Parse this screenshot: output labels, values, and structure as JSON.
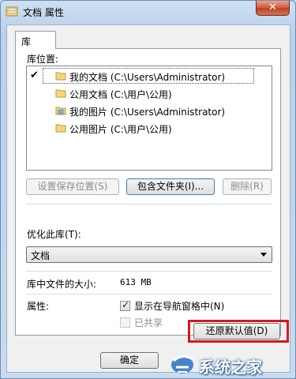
{
  "window": {
    "title": "文档 属性",
    "close_label": "✕"
  },
  "tabs": [
    {
      "label": "库"
    }
  ],
  "library_locations": {
    "label": "库位置:",
    "items": [
      {
        "text": "我的文档 (C:\\Users\\Administrator)",
        "checked": true,
        "icon": "folder-icon"
      },
      {
        "text": "公用文档 (C:\\用户\\公用)",
        "checked": false,
        "icon": "folder-icon"
      },
      {
        "text": "我的图片 (C:\\Users\\Administrator)",
        "checked": false,
        "icon": "pictures-folder-icon"
      },
      {
        "text": "公用图片 (C:\\用户\\公用)",
        "checked": false,
        "icon": "folder-icon"
      }
    ]
  },
  "location_buttons": {
    "set_save_location": "设置保存位置(S)",
    "include_folder": "包含文件夹(I)...",
    "remove": "删除(R)"
  },
  "optimize": {
    "label": "优化此库(T):",
    "selected": "文档"
  },
  "size": {
    "label": "库中文件的大小:",
    "value": "613 MB"
  },
  "attributes": {
    "label": "属性:",
    "show_in_nav": {
      "label": "显示在导航窗格中(N)",
      "checked": true
    },
    "shared": {
      "label": "已共享",
      "checked": false,
      "disabled": true
    }
  },
  "restore_defaults": "还原默认值(D)",
  "footer": {
    "ok": "确定"
  },
  "watermark": {
    "text": "系统之家"
  },
  "colors": {
    "highlight": "#d41a1a",
    "close_button": "#c03f1f"
  }
}
